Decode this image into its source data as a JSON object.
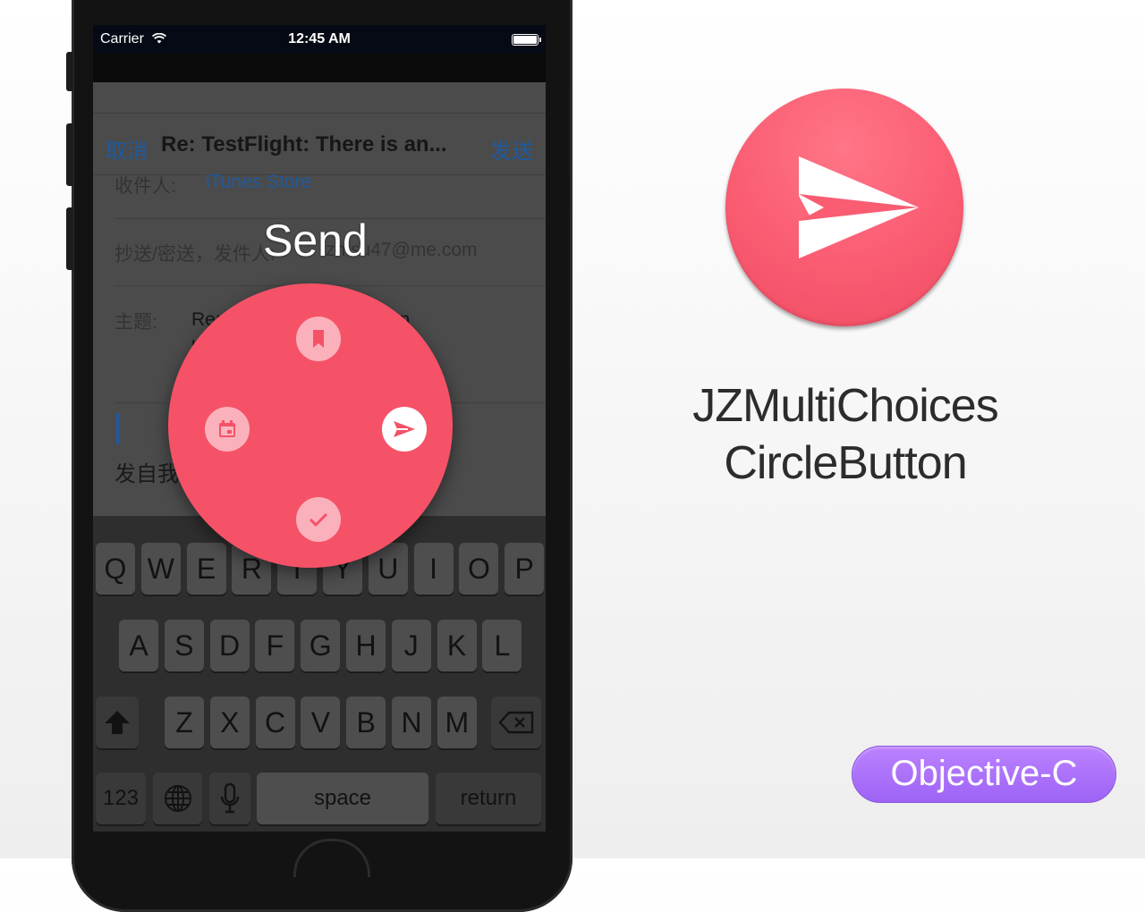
{
  "status_bar": {
    "carrier": "Carrier",
    "time": "12:45 AM"
  },
  "mail": {
    "cancel_label": "取消",
    "title": "Re: TestFlight: There is an...",
    "send_label": "发送",
    "to_label": "收件人:",
    "to_value": "iTunes Store",
    "cc_label": "抄送/密送，发件人:",
    "cc_value": "zhtsu47@me.com",
    "subject_label": "主题:",
    "subject_value": "Re: TestFlight: There is an update",
    "signature": "发自我的 iPhone"
  },
  "keyboard": {
    "row1": [
      "Q",
      "W",
      "E",
      "R",
      "T",
      "Y",
      "U",
      "I",
      "O",
      "P"
    ],
    "row2": [
      "A",
      "S",
      "D",
      "F",
      "G",
      "H",
      "J",
      "K",
      "L"
    ],
    "row3": [
      "Z",
      "X",
      "C",
      "V",
      "B",
      "N",
      "M"
    ],
    "numbers_label": "123",
    "space_label": "space",
    "return_label": "return"
  },
  "radial_menu": {
    "label": "Send",
    "items": [
      {
        "icon": "bookmark-icon",
        "active": false
      },
      {
        "icon": "calendar-icon",
        "active": false
      },
      {
        "icon": "send-icon",
        "active": true
      },
      {
        "icon": "check-icon",
        "active": false
      }
    ],
    "color": "#f55268"
  },
  "promo": {
    "title_line1": "JZMultiChoices",
    "title_line2": "CircleButton",
    "language": "Objective-C",
    "circle_color": "#fa5c72",
    "badge_color": "#a86cf9"
  }
}
